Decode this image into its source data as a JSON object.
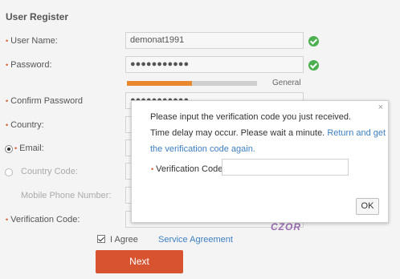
{
  "form": {
    "title": "User Register",
    "labels": {
      "username": "User Name:",
      "password": "Password:",
      "confirm": "Confirm Password",
      "country": "Country:",
      "email": "Email:",
      "country_code": "Country Code:",
      "mobile": "Mobile Phone Number:",
      "verification": "Verification Code:"
    },
    "values": {
      "username": "demonat1991",
      "password": "●●●●●●●●●●●",
      "confirm": "●●●●●●●●●●●",
      "country": "",
      "email": "",
      "country_code": "",
      "mobile": "",
      "verification": ""
    },
    "password_strength": {
      "label": "General",
      "fraction": 0.5
    },
    "selected_contact": "email",
    "agree": {
      "checked": true,
      "label": "I Agree",
      "link": "Service Agreement"
    },
    "next_label": "Next",
    "captcha_text": "CZOR"
  },
  "modal": {
    "close_glyph": "×",
    "line1": "Please input the verification code you just received.",
    "line2_prefix": "Time delay may occur. Please wait a minute.",
    "line2_link": "Return and get",
    "line3_link": "the verification code again.",
    "code_label": "Verification Code:",
    "code_value": "",
    "ok_label": "OK"
  },
  "colors": {
    "accent": "#d8532f",
    "link": "#3d7fc1",
    "strength_bar": "#e8872e",
    "valid": "#4caf50"
  },
  "icons": {
    "valid": "check-circle-icon",
    "close": "close-icon"
  }
}
